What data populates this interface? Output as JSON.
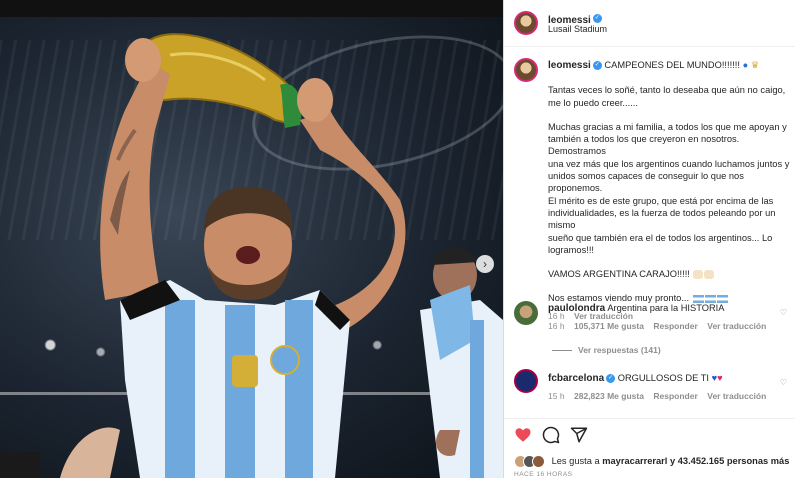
{
  "post": {
    "author": "leomessi",
    "location": "Lusail Stadium",
    "caption_title": "CAMPEONES DEL MUNDO!!!!!!!",
    "caption_p1": "Tantas veces lo soñé, tanto lo deseaba que aún no caigo,\nme lo puedo creer......",
    "caption_p2": "Muchas gracias a mi familia, a todos los que me apoyan y\ntambién a todos los que creyeron en nosotros. Demostramos\nuna vez más que los argentinos cuando luchamos juntos y\nunidos somos capaces de conseguir lo que nos proponemos.\nEl mérito es de este grupo, que está por encima de las\nindividualidades, es la fuerza de todos peleando por un mismo\nsueño que también era el de todos los argentinos... Lo\nlogramos!!!",
    "caption_p3": "VAMOS ARGENTINA CARAJO!!!!!",
    "caption_p4": "Nos estamos viendo muy pronto...",
    "time": "16 h",
    "see_translation": "Ver traducción"
  },
  "comments": [
    {
      "user": "paulolondra",
      "text": "Argentina para la HISTORIA",
      "time": "16 h",
      "likes": "105,371 Me gusta",
      "reply": "Responder",
      "translate": "Ver traducción",
      "replies": "Ver respuestas (141)"
    },
    {
      "user": "fcbarcelona",
      "text": "ORGULLOSOS DE TI",
      "time": "15 h",
      "likes": "282,823 Me gusta",
      "reply": "Responder",
      "translate": "Ver traducción"
    }
  ],
  "footer": {
    "likes_prefix": "Les gusta a ",
    "likes_user": "mayracarrerarl",
    "likes_suffix": " y 43.452.165 personas más",
    "time_ago": "HACE 16 HORAS"
  },
  "icons": [
    "heart-icon",
    "comment-icon",
    "share-icon",
    "chevron-right-icon",
    "verified-icon"
  ],
  "colors": {
    "heart": "#ed4956",
    "verified": "#3897f0",
    "meta": "#8e8e8e"
  }
}
